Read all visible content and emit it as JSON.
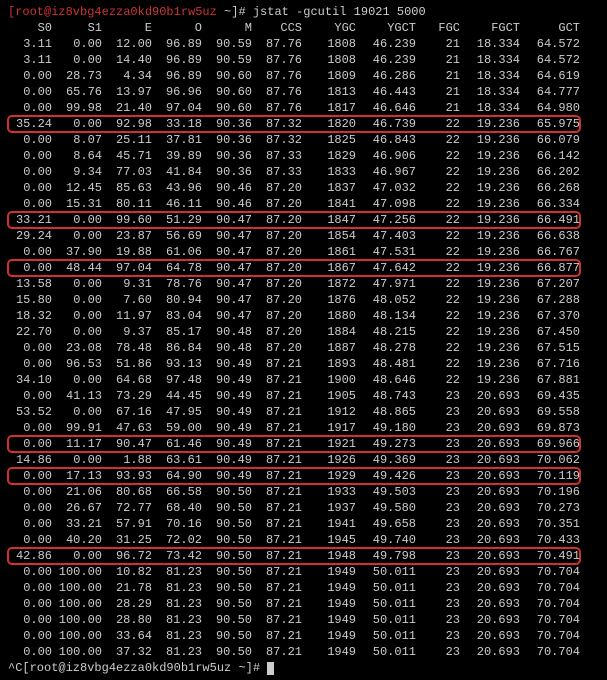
{
  "prompt": {
    "user_host": "[root@iz8vbg4ezza0kd90b1rw5uz ",
    "path": "~",
    "bracket": "]# ",
    "cmd": "jstat -gcutil 19021 5000"
  },
  "headers": [
    "S0",
    "S1",
    "E",
    "O",
    "M",
    "CCS",
    "YGC",
    "YGCT",
    "FGC",
    "FGCT",
    "GCT"
  ],
  "rows": [
    {
      "v": [
        "3.11",
        "0.00",
        "12.00",
        "96.89",
        "90.59",
        "87.76",
        "1808",
        "46.239",
        "21",
        "18.334",
        "64.572"
      ],
      "hl": false
    },
    {
      "v": [
        "3.11",
        "0.00",
        "14.40",
        "96.89",
        "90.59",
        "87.76",
        "1808",
        "46.239",
        "21",
        "18.334",
        "64.572"
      ],
      "hl": false
    },
    {
      "v": [
        "0.00",
        "28.73",
        "4.34",
        "96.89",
        "90.60",
        "87.76",
        "1809",
        "46.286",
        "21",
        "18.334",
        "64.619"
      ],
      "hl": false
    },
    {
      "v": [
        "0.00",
        "65.76",
        "13.97",
        "96.96",
        "90.60",
        "87.76",
        "1813",
        "46.443",
        "21",
        "18.334",
        "64.777"
      ],
      "hl": false
    },
    {
      "v": [
        "0.00",
        "99.98",
        "21.40",
        "97.04",
        "90.60",
        "87.76",
        "1817",
        "46.646",
        "21",
        "18.334",
        "64.980"
      ],
      "hl": false
    },
    {
      "v": [
        "35.24",
        "0.00",
        "92.98",
        "33.18",
        "90.36",
        "87.32",
        "1820",
        "46.739",
        "22",
        "19.236",
        "65.975"
      ],
      "hl": true
    },
    {
      "v": [
        "0.00",
        "8.07",
        "25.11",
        "37.81",
        "90.36",
        "87.32",
        "1825",
        "46.843",
        "22",
        "19.236",
        "66.079"
      ],
      "hl": false
    },
    {
      "v": [
        "0.00",
        "8.64",
        "45.71",
        "39.89",
        "90.36",
        "87.33",
        "1829",
        "46.906",
        "22",
        "19.236",
        "66.142"
      ],
      "hl": false
    },
    {
      "v": [
        "0.00",
        "9.34",
        "77.03",
        "41.84",
        "90.36",
        "87.33",
        "1833",
        "46.967",
        "22",
        "19.236",
        "66.202"
      ],
      "hl": false
    },
    {
      "v": [
        "0.00",
        "12.45",
        "85.63",
        "43.96",
        "90.46",
        "87.20",
        "1837",
        "47.032",
        "22",
        "19.236",
        "66.268"
      ],
      "hl": false
    },
    {
      "v": [
        "0.00",
        "15.31",
        "80.11",
        "46.11",
        "90.46",
        "87.20",
        "1841",
        "47.098",
        "22",
        "19.236",
        "66.334"
      ],
      "hl": false
    },
    {
      "v": [
        "33.21",
        "0.00",
        "99.60",
        "51.29",
        "90.47",
        "87.20",
        "1847",
        "47.256",
        "22",
        "19.236",
        "66.491"
      ],
      "hl": true
    },
    {
      "v": [
        "29.24",
        "0.00",
        "23.87",
        "56.69",
        "90.47",
        "87.20",
        "1854",
        "47.403",
        "22",
        "19.236",
        "66.638"
      ],
      "hl": false
    },
    {
      "v": [
        "0.00",
        "37.90",
        "19.88",
        "61.06",
        "90.47",
        "87.20",
        "1861",
        "47.531",
        "22",
        "19.236",
        "66.767"
      ],
      "hl": false
    },
    {
      "v": [
        "0.00",
        "48.44",
        "97.04",
        "64.78",
        "90.47",
        "87.20",
        "1867",
        "47.642",
        "22",
        "19.236",
        "66.877"
      ],
      "hl": true
    },
    {
      "v": [
        "13.58",
        "0.00",
        "9.31",
        "78.76",
        "90.47",
        "87.20",
        "1872",
        "47.971",
        "22",
        "19.236",
        "67.207"
      ],
      "hl": false
    },
    {
      "v": [
        "15.80",
        "0.00",
        "7.60",
        "80.94",
        "90.47",
        "87.20",
        "1876",
        "48.052",
        "22",
        "19.236",
        "67.288"
      ],
      "hl": false
    },
    {
      "v": [
        "18.32",
        "0.00",
        "11.97",
        "83.04",
        "90.47",
        "87.20",
        "1880",
        "48.134",
        "22",
        "19.236",
        "67.370"
      ],
      "hl": false
    },
    {
      "v": [
        "22.70",
        "0.00",
        "9.37",
        "85.17",
        "90.48",
        "87.20",
        "1884",
        "48.215",
        "22",
        "19.236",
        "67.450"
      ],
      "hl": false
    },
    {
      "v": [
        "0.00",
        "23.08",
        "78.48",
        "86.84",
        "90.48",
        "87.20",
        "1887",
        "48.278",
        "22",
        "19.236",
        "67.515"
      ],
      "hl": false
    },
    {
      "v": [
        "0.00",
        "96.53",
        "51.86",
        "93.13",
        "90.49",
        "87.21",
        "1893",
        "48.481",
        "22",
        "19.236",
        "67.716"
      ],
      "hl": false
    },
    {
      "v": [
        "34.10",
        "0.00",
        "64.68",
        "97.48",
        "90.49",
        "87.21",
        "1900",
        "48.646",
        "22",
        "19.236",
        "67.881"
      ],
      "hl": false
    },
    {
      "v": [
        "0.00",
        "41.13",
        "73.29",
        "44.45",
        "90.49",
        "87.21",
        "1905",
        "48.743",
        "23",
        "20.693",
        "69.435"
      ],
      "hl": false
    },
    {
      "v": [
        "53.52",
        "0.00",
        "67.16",
        "47.95",
        "90.49",
        "87.21",
        "1912",
        "48.865",
        "23",
        "20.693",
        "69.558"
      ],
      "hl": false
    },
    {
      "v": [
        "0.00",
        "99.91",
        "47.63",
        "59.00",
        "90.49",
        "87.21",
        "1917",
        "49.180",
        "23",
        "20.693",
        "69.873"
      ],
      "hl": false
    },
    {
      "v": [
        "0.00",
        "11.17",
        "90.47",
        "61.46",
        "90.49",
        "87.21",
        "1921",
        "49.273",
        "23",
        "20.693",
        "69.966"
      ],
      "hl": true
    },
    {
      "v": [
        "14.86",
        "0.00",
        "1.88",
        "63.61",
        "90.49",
        "87.21",
        "1926",
        "49.369",
        "23",
        "20.693",
        "70.062"
      ],
      "hl": false
    },
    {
      "v": [
        "0.00",
        "17.13",
        "93.93",
        "64.90",
        "90.49",
        "87.21",
        "1929",
        "49.426",
        "23",
        "20.693",
        "70.119"
      ],
      "hl": true
    },
    {
      "v": [
        "0.00",
        "21.06",
        "80.68",
        "66.58",
        "90.50",
        "87.21",
        "1933",
        "49.503",
        "23",
        "20.693",
        "70.196"
      ],
      "hl": false
    },
    {
      "v": [
        "0.00",
        "26.67",
        "72.77",
        "68.40",
        "90.50",
        "87.21",
        "1937",
        "49.580",
        "23",
        "20.693",
        "70.273"
      ],
      "hl": false
    },
    {
      "v": [
        "0.00",
        "33.21",
        "57.91",
        "70.16",
        "90.50",
        "87.21",
        "1941",
        "49.658",
        "23",
        "20.693",
        "70.351"
      ],
      "hl": false
    },
    {
      "v": [
        "0.00",
        "40.20",
        "31.25",
        "72.02",
        "90.50",
        "87.21",
        "1945",
        "49.740",
        "23",
        "20.693",
        "70.433"
      ],
      "hl": false
    },
    {
      "v": [
        "42.86",
        "0.00",
        "96.72",
        "73.42",
        "90.50",
        "87.21",
        "1948",
        "49.798",
        "23",
        "20.693",
        "70.491"
      ],
      "hl": true
    },
    {
      "v": [
        "0.00",
        "100.00",
        "10.82",
        "81.23",
        "90.50",
        "87.21",
        "1949",
        "50.011",
        "23",
        "20.693",
        "70.704"
      ],
      "hl": false
    },
    {
      "v": [
        "0.00",
        "100.00",
        "21.78",
        "81.23",
        "90.50",
        "87.21",
        "1949",
        "50.011",
        "23",
        "20.693",
        "70.704"
      ],
      "hl": false
    },
    {
      "v": [
        "0.00",
        "100.00",
        "28.29",
        "81.23",
        "90.50",
        "87.21",
        "1949",
        "50.011",
        "23",
        "20.693",
        "70.704"
      ],
      "hl": false
    },
    {
      "v": [
        "0.00",
        "100.00",
        "28.80",
        "81.23",
        "90.50",
        "87.21",
        "1949",
        "50.011",
        "23",
        "20.693",
        "70.704"
      ],
      "hl": false
    },
    {
      "v": [
        "0.00",
        "100.00",
        "33.64",
        "81.23",
        "90.50",
        "87.21",
        "1949",
        "50.011",
        "23",
        "20.693",
        "70.704"
      ],
      "hl": false
    },
    {
      "v": [
        "0.00",
        "100.00",
        "37.32",
        "81.23",
        "90.50",
        "87.21",
        "1949",
        "50.011",
        "23",
        "20.693",
        "70.704"
      ],
      "hl": false
    }
  ],
  "cursor_line": "^C[root@iz8vbg4ezza0kd90b1rw5uz ~]# "
}
